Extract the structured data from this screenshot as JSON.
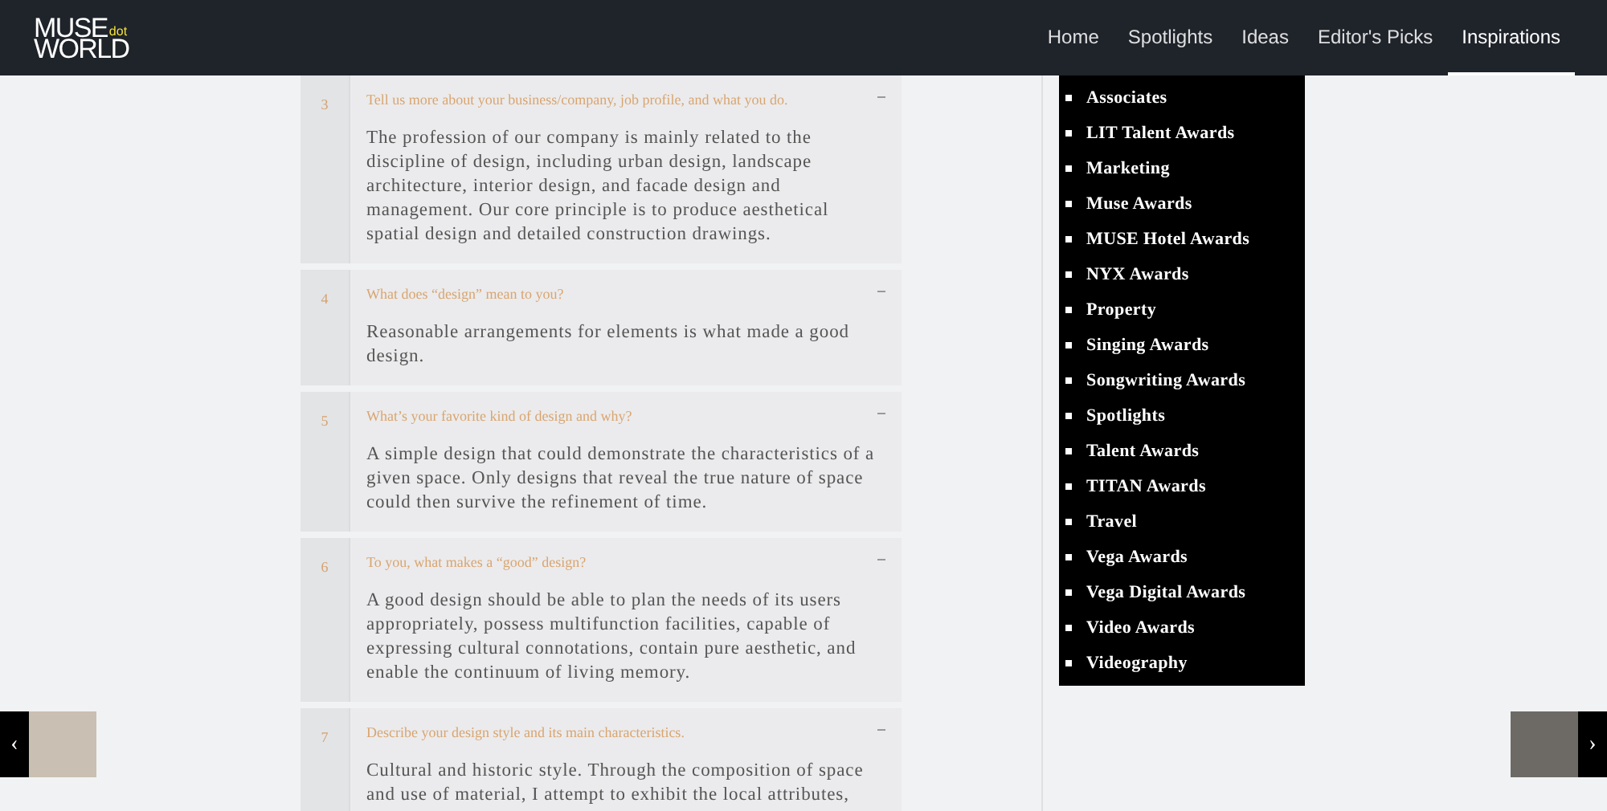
{
  "header": {
    "logo": {
      "top": "MUSE",
      "mark": "dot",
      "bottom": "WORLD"
    },
    "nav": [
      {
        "label": "Home",
        "selected": false
      },
      {
        "label": "Spotlights",
        "selected": false
      },
      {
        "label": "Ideas",
        "selected": false
      },
      {
        "label": "Editor's Picks",
        "selected": false
      },
      {
        "label": "Inspirations",
        "selected": true
      }
    ]
  },
  "interview": [
    {
      "number": "3",
      "question": "Tell us more about your business/company, job profile, and what you do.",
      "expanded": true,
      "answer": "The profession of our company is mainly related to the discipline of design, including urban design, landscape architecture, interior design, and facade design and management. Our core principle is to produce aesthetical spatial design and detailed construction drawings."
    },
    {
      "number": "4",
      "question": "What does “design” mean to you?",
      "expanded": true,
      "answer": "Reasonable arrangements for elements is what made a good design."
    },
    {
      "number": "5",
      "question": "What’s your favorite kind of design and why?",
      "expanded": true,
      "answer": "A simple design that could demonstrate the characteristics of a given space. Only designs that reveal the true nature of space could then survive the refinement of time."
    },
    {
      "number": "6",
      "question": "To you, what makes a “good” design?",
      "expanded": true,
      "answer": "A good design should be able to plan the needs of its users appropriately, possess multifunction facilities, capable of expressing cultural connotations, contain pure aesthetic, and enable the continuum of living memory."
    },
    {
      "number": "7",
      "question": "Describe your design style and its main characteristics.",
      "expanded": true,
      "answer": "Cultural and historic style. Through the composition of space and use of material, I attempt to exhibit the local attributes,"
    }
  ],
  "categories_menu": [
    "Associates",
    "LIT Talent Awards",
    "Marketing",
    "Muse Awards",
    "MUSE Hotel Awards",
    "NYX Awards",
    "Property",
    "Singing Awards",
    "Songwriting Awards",
    "Spotlights",
    "Talent Awards",
    "TITAN Awards",
    "Travel",
    "Vega Awards",
    "Vega Digital Awards",
    "Video Awards",
    "Videography"
  ],
  "post_nav": {
    "previous": {
      "arrow": "‹"
    },
    "next": {
      "arrow": "›"
    }
  }
}
